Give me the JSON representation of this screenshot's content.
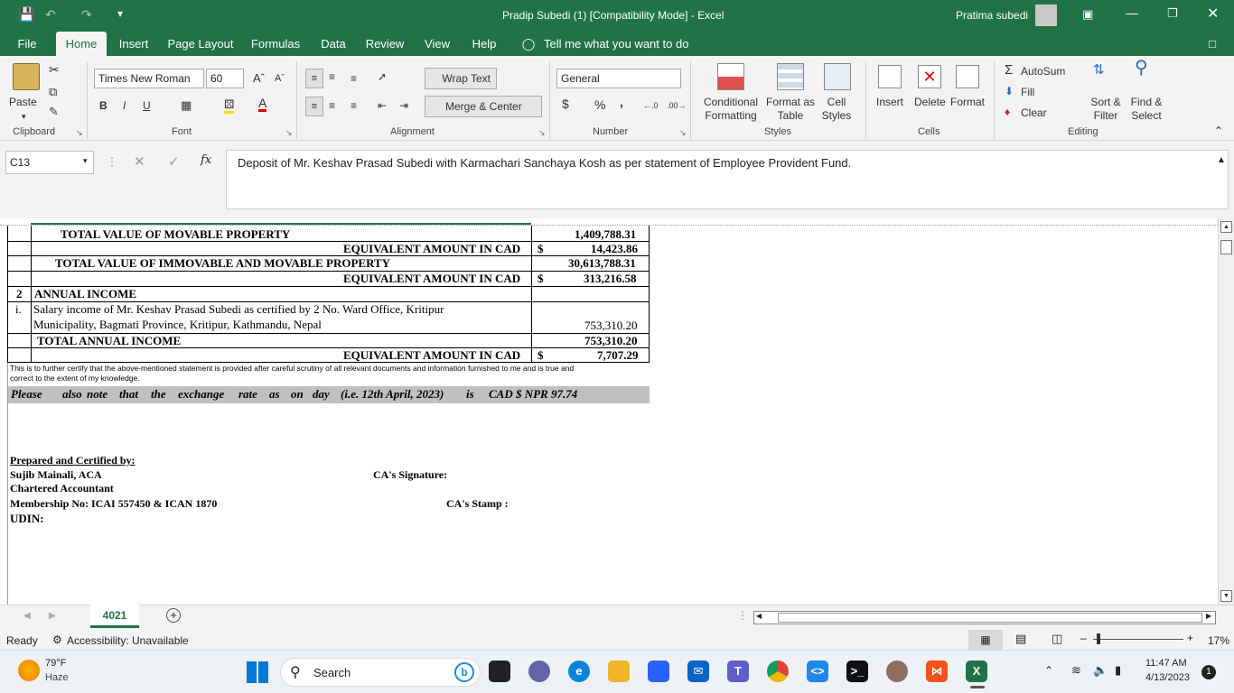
{
  "title_bar": {
    "document_title": "Pradip Subedi (1)  [Compatibility Mode]  -  Excel",
    "user_name": "Pratima subedi",
    "accent_color": "#217346"
  },
  "ribbon_tabs": [
    "File",
    "Home",
    "Insert",
    "Page Layout",
    "Formulas",
    "Data",
    "Review",
    "View",
    "Help"
  ],
  "tell_me": "Tell me what you want to do",
  "ribbon": {
    "clipboard": {
      "paste": "Paste",
      "label": "Clipboard"
    },
    "font": {
      "family": "Times New Roman",
      "size": "60",
      "bold": "B",
      "italic": "I",
      "underline": "U",
      "label": "Font"
    },
    "alignment": {
      "wrap_text": "Wrap Text",
      "merge_center": "Merge & Center",
      "label": "Alignment"
    },
    "number": {
      "format": "General",
      "currency": "$",
      "percent": "%",
      "comma": ",",
      "label": "Number"
    },
    "styles": {
      "conditional": "Conditional",
      "conditional2": "Formatting",
      "format_as": "Format as",
      "format_as2": "Table",
      "cell": "Cell",
      "cell2": "Styles",
      "label": "Styles"
    },
    "cells": {
      "insert": "Insert",
      "delete": "Delete",
      "format": "Format",
      "label": "Cells"
    },
    "editing": {
      "autosum": "AutoSum",
      "fill": "Fill",
      "clear": "Clear",
      "sort": "Sort &",
      "sort2": "Filter",
      "find": "Find &",
      "find2": "Select",
      "label": "Editing"
    }
  },
  "formula_bar": {
    "name_box": "C13",
    "fx": "fx",
    "content": "Deposit of Mr. Keshav Prasad Subedi with Karmachari Sanchaya Kosh as per statement of Employee Provident Fund."
  },
  "sheet": {
    "rows": {
      "r1_label": "TOTAL VALUE OF MOVABLE PROPERTY",
      "r1_value": "1,409,788.31",
      "r2_label": "EQUIVALENT AMOUNT IN CAD",
      "r2_sym": "$",
      "r2_value": "14,423.86",
      "r3_label": "TOTAL VALUE OF IMMOVABLE AND MOVABLE PROPERTY",
      "r3_value": "30,613,788.31",
      "r4_label": "EQUIVALENT AMOUNT IN CAD",
      "r4_sym": "$",
      "r4_value": "313,216.58",
      "r5_num": "2",
      "r5_label": "ANNUAL INCOME",
      "r6_num": "i.",
      "r6_line1": "Salary income of Mr. Keshav Prasad Subedi as certified by 2 No. Ward Office, Kritipur",
      "r6_line2": "Municipality, Bagmati Province, Kritipur, Kathmandu, Nepal",
      "r6_value": "753,310.20",
      "r7_label": "TOTAL ANNUAL INCOME",
      "r7_value": "753,310.20",
      "r8_label": "EQUIVALENT AMOUNT IN CAD",
      "r8_sym": "$",
      "r8_value": "7,707.29",
      "certify1": "This is to further certify that the above-mentioned statement is provided after careful scrutiny of all relevant documents and information furnished to me and is true and",
      "certify2": "correct to the extent of my knowledge.",
      "note_words": [
        "Please",
        "also",
        "note",
        "that",
        "the",
        "exchange",
        "rate",
        "as",
        "on",
        "day",
        "(i.e. 12th April, 2023)",
        "is",
        "CAD $  NPR 97.74"
      ],
      "prepared": "Prepared and Certified by:",
      "name": "Sujib Mainali, ACA",
      "title": "Chartered Accountant",
      "membership": "Membership No: ICAI 557450 & ICAN 1870",
      "udin": "UDIN:",
      "ca_signature": "CA's Signature:",
      "ca_stamp": "CA's Stamp :"
    }
  },
  "sheet_tabs": {
    "active": "4021"
  },
  "status_bar": {
    "ready": "Ready",
    "accessibility": "Accessibility: Unavailable",
    "zoom": "17%"
  },
  "taskbar": {
    "weather_temp": "79°F",
    "weather_desc": "Haze",
    "search": "Search",
    "time": "11:47 AM",
    "date": "4/13/2023",
    "notification_count": "1"
  }
}
